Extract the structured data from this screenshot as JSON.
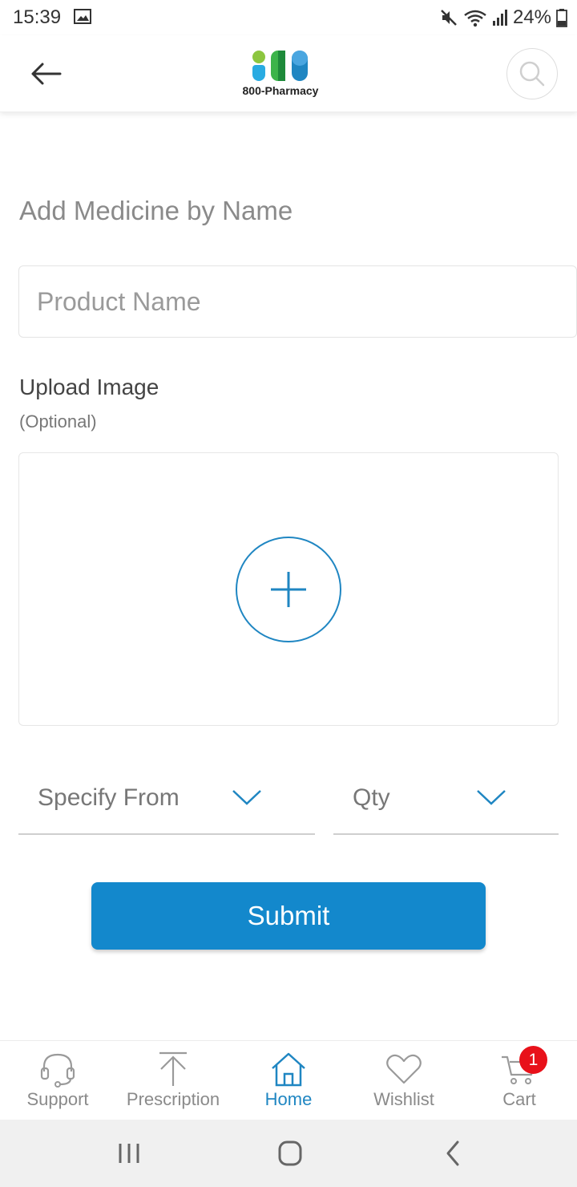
{
  "status_bar": {
    "time": "15:39",
    "battery": "24%"
  },
  "header": {
    "logo_text": "800-Pharmacy"
  },
  "form": {
    "title": "Add Medicine by Name",
    "product_placeholder": "Product Name",
    "upload_label": "Upload Image",
    "upload_optional": "(Optional)",
    "specify_from": "Specify From",
    "qty": "Qty",
    "submit": "Submit"
  },
  "bottom_nav": {
    "items": [
      {
        "label": "Support",
        "icon": "headset-icon"
      },
      {
        "label": "Prescription",
        "icon": "upload-arrow-icon"
      },
      {
        "label": "Home",
        "icon": "home-icon",
        "active": true
      },
      {
        "label": "Wishlist",
        "icon": "heart-icon"
      },
      {
        "label": "Cart",
        "icon": "cart-icon"
      }
    ],
    "cart_count": "1"
  },
  "colors": {
    "accent": "#1388cc",
    "badge": "#e8111a"
  }
}
